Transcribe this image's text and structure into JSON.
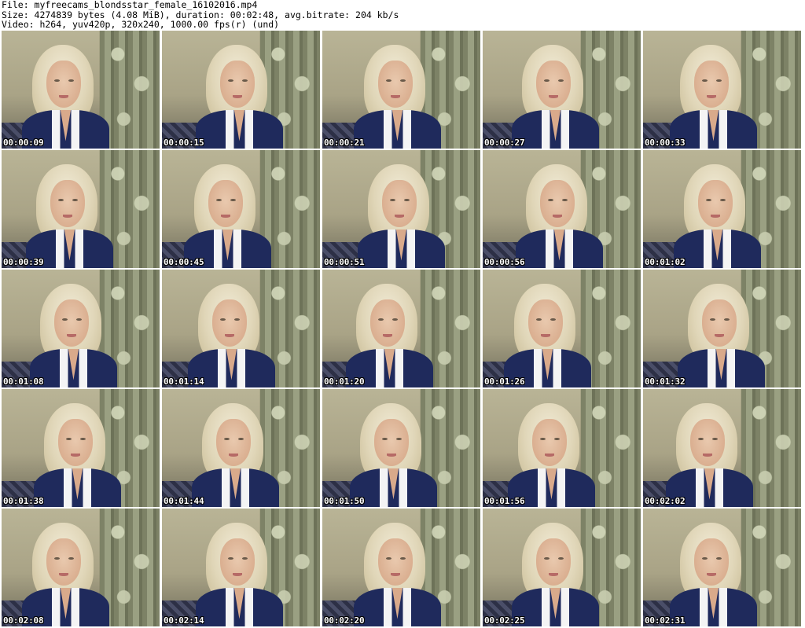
{
  "header": {
    "line1": "File: myfreecams_blondsstar_female_16102016.mp4",
    "line2": "Size: 4274839 bytes (4.08 MiB), duration: 00:02:48, avg.bitrate: 204 kb/s",
    "line3": "Video: h264, yuv420p, 320x240, 1000.00 fps(r) (und)"
  },
  "thumbnails": [
    "00:00:09",
    "00:00:15",
    "00:00:21",
    "00:00:27",
    "00:00:33",
    "00:00:39",
    "00:00:45",
    "00:00:51",
    "00:00:56",
    "00:01:02",
    "00:01:08",
    "00:01:14",
    "00:01:20",
    "00:01:26",
    "00:01:32",
    "00:01:38",
    "00:01:44",
    "00:01:50",
    "00:01:56",
    "00:02:02",
    "00:02:08",
    "00:02:14",
    "00:02:20",
    "00:02:25",
    "00:02:31"
  ]
}
